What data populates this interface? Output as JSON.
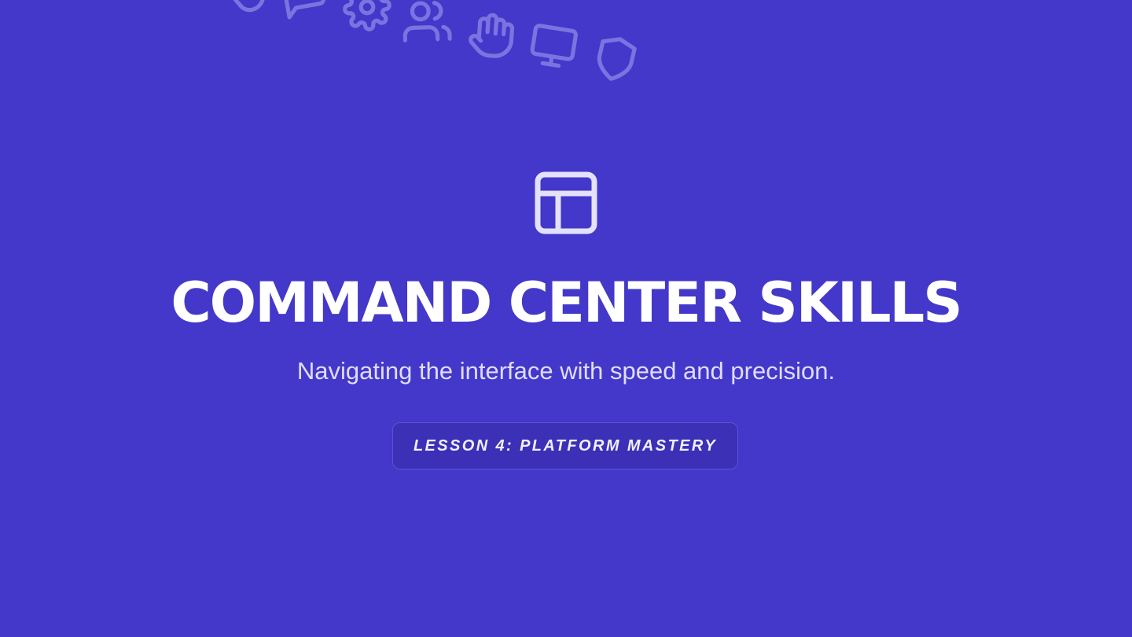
{
  "slide": {
    "title": "COMMAND CENTER SKILLS",
    "subtitle": "Navigating the interface with speed and precision.",
    "badge": "LESSON 4: PLATFORM MASTERY",
    "hero_icon": "layout-icon",
    "decorative_icons": [
      "hand-pointer-icon",
      "chat-icon",
      "gear-icon",
      "users-icon",
      "hand-icon",
      "monitor-icon",
      "shield-icon"
    ]
  },
  "colors": {
    "background": "#4338ca",
    "title": "#ffffff",
    "subtitle": "#e0ddfb",
    "badge_background": "#3b30b6",
    "decorative_icon": "#7b74e0"
  }
}
